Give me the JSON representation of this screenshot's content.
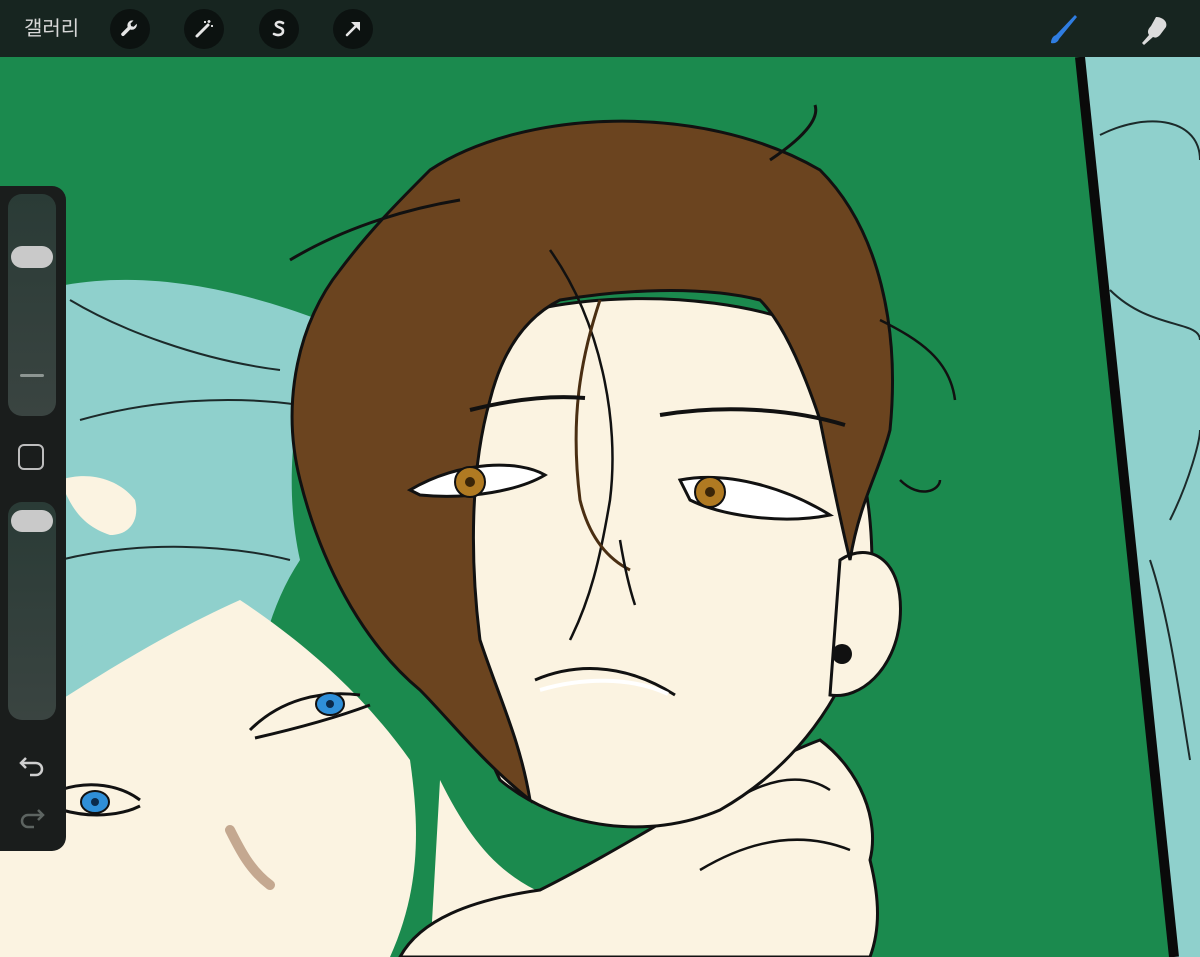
{
  "toolbar": {
    "gallery_label": "갤러리",
    "left_tools": [
      {
        "icon": "wrench-icon",
        "action": "actions"
      },
      {
        "icon": "magic-wand-icon",
        "action": "adjustments"
      },
      {
        "icon": "selection-s-icon",
        "action": "selection"
      },
      {
        "icon": "arrow-cursor-icon",
        "action": "transform"
      }
    ],
    "right_tools": [
      {
        "icon": "brush-icon",
        "action": "paint",
        "active": true,
        "color": "#2f7de1"
      },
      {
        "icon": "smudge-icon",
        "action": "smudge"
      }
    ]
  },
  "sidebar": {
    "brush_size": 0.12,
    "opacity": 0.05,
    "icons": [
      "modify-square-icon",
      "undo-icon",
      "redo-icon"
    ]
  },
  "canvas": {
    "background_color": "#1b8a4e",
    "hair_colors": {
      "front_character": "#6b441f",
      "back_character": "#8fd0cc"
    },
    "skin_color": "#fbf3e1",
    "eye_colors": {
      "front_character": "#b07a22",
      "back_character": "#2f8fd8"
    }
  }
}
